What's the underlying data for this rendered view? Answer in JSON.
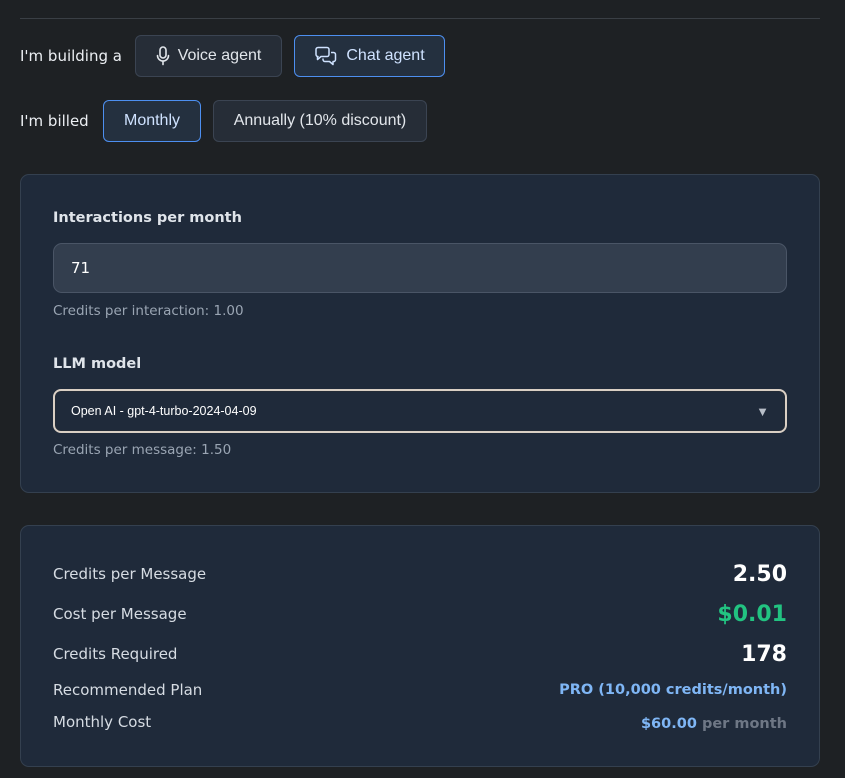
{
  "agent": {
    "label": "I'm building a",
    "options": [
      {
        "label": "Voice agent",
        "icon": "microphone-icon",
        "selected": false
      },
      {
        "label": "Chat agent",
        "icon": "chat-bubbles-icon",
        "selected": true
      }
    ]
  },
  "billing": {
    "label": "I'm billed",
    "options": [
      {
        "label": "Monthly",
        "selected": true
      },
      {
        "label": "Annually (10% discount)",
        "selected": false
      }
    ]
  },
  "inputs": {
    "interactions_label": "Interactions per month",
    "interactions_value": "71",
    "credits_per_interaction": "Credits per interaction: 1.00",
    "llm_label": "LLM model",
    "llm_value": "Open AI - gpt-4-turbo-2024-04-09",
    "credits_per_message": "Credits per message: 1.50"
  },
  "summary": {
    "credits_per_message_label": "Credits per Message",
    "credits_per_message_value": "2.50",
    "cost_per_message_label": "Cost per Message",
    "cost_per_message_value": "$0.01",
    "credits_required_label": "Credits Required",
    "credits_required_value": "178",
    "recommended_plan_label": "Recommended Plan",
    "recommended_plan_value": "PRO (10,000 credits/month)",
    "monthly_cost_label": "Monthly Cost",
    "monthly_cost_value": "$60.00",
    "monthly_cost_suffix": "per month"
  },
  "colors": {
    "accent": "#4d8ff0",
    "green": "#22c381",
    "link": "#7fb6f5",
    "background": "#1e2124",
    "card": "#1f2a3a"
  }
}
